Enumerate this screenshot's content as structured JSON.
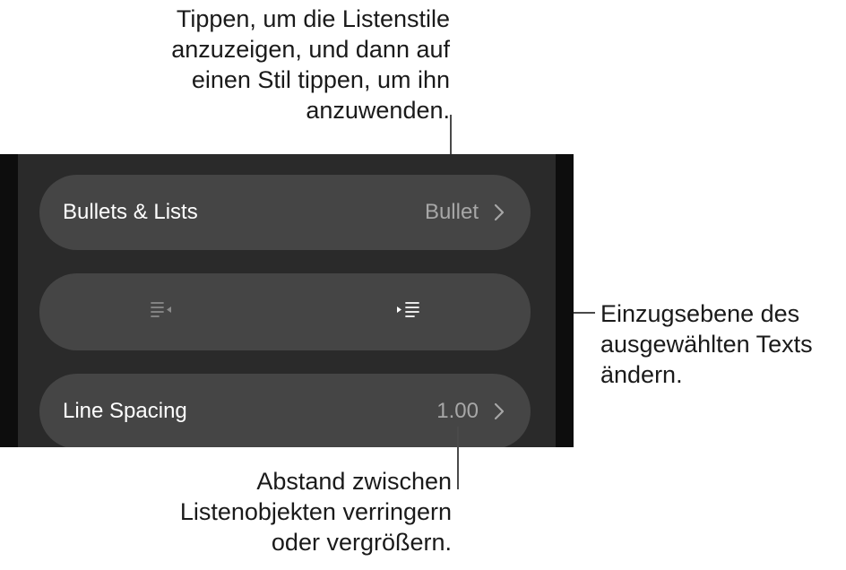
{
  "callouts": {
    "list_styles": "Tippen, um die Listenstile\nanzuzeigen, und dann auf\neinen Stil tippen, um ihn\nanzuwenden.",
    "indent_level": "Einzugsebene des\nausgewählten Texts\nändern.",
    "line_spacing": "Abstand zwischen\nListenobjekten verringern\noder vergrößern."
  },
  "panel": {
    "bullets_lists": {
      "title": "Bullets & Lists",
      "value": "Bullet"
    },
    "indent_controls": {
      "decrease_icon": "decrease-indent-icon",
      "increase_icon": "increase-indent-icon",
      "decrease_enabled": false,
      "increase_enabled": true
    },
    "line_spacing": {
      "title": "Line Spacing",
      "value": "1.00"
    }
  },
  "colors": {
    "panel_background": "#2a2a2a",
    "pill_background": "#454545",
    "value_text": "#a7a7a7",
    "disabled_icon": "#8a8a8a",
    "callout_text": "#1a1a1a"
  }
}
